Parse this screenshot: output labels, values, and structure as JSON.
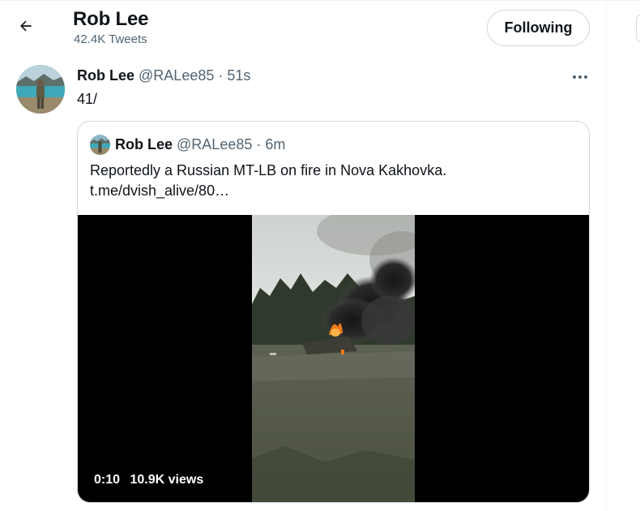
{
  "header": {
    "back_icon": "arrow-left-icon",
    "title": "Rob Lee",
    "tweet_count": "42.4K Tweets",
    "follow_label": "Following"
  },
  "tweet": {
    "author_name": "Rob Lee",
    "handle": "@RALee85",
    "separator": "·",
    "time": "51s",
    "text": "41/",
    "more_icon": "more-options-icon"
  },
  "quote": {
    "author_name": "Rob Lee",
    "handle": "@RALee85",
    "separator": "·",
    "time": "6m",
    "text": "Reportedly a Russian MT-LB on fire in Nova Kakhovka.",
    "link": "t.me/dvish_alive/80…",
    "video": {
      "duration": "0:10",
      "views": "10.9K views"
    }
  },
  "colors": {
    "text_primary": "#0f1419",
    "text_secondary": "#536471",
    "border": "#cfd9de",
    "video_bg": "#000000"
  }
}
